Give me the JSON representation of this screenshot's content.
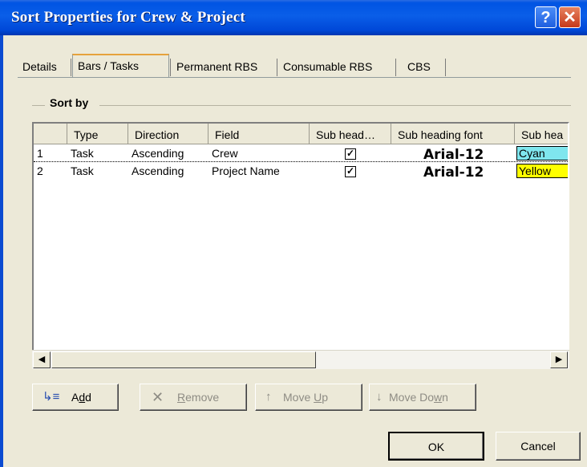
{
  "window": {
    "title": "Sort  Properties for  Crew & Project",
    "help_glyph": "?",
    "close_glyph": "✕"
  },
  "tabs": [
    {
      "label": "Details"
    },
    {
      "label": "Bars / Tasks"
    },
    {
      "label": "Permanent RBS"
    },
    {
      "label": "Consumable RBS"
    },
    {
      "label": "CBS"
    }
  ],
  "active_tab": "Bars / Tasks",
  "group": {
    "label": "Sort by"
  },
  "grid": {
    "columns": [
      "",
      "Type",
      "Direction",
      "Field",
      "Sub head…",
      "Sub heading font",
      "Sub hea"
    ],
    "rows": [
      {
        "num": "1",
        "type": "Task",
        "direction": "Ascending",
        "field": "Crew",
        "sub_head_checked": true,
        "check_glyph": "✓",
        "font": "Arial-12",
        "color": "Cyan",
        "color_hex": "#7fe6ee"
      },
      {
        "num": "2",
        "type": "Task",
        "direction": "Ascending",
        "field": "Project Name",
        "sub_head_checked": true,
        "check_glyph": "✓",
        "font": "Arial-12",
        "color": "Yellow",
        "color_hex": "#ffff00"
      }
    ]
  },
  "scrollbar": {
    "left_arrow": "◀",
    "right_arrow": "▶"
  },
  "buttons": {
    "add": {
      "icon": "↳≡",
      "label_pre": "A",
      "label_ul": "d",
      "label_post": "d"
    },
    "remove": {
      "icon": "✕",
      "label_pre": "",
      "label_ul": "R",
      "label_post": "emove"
    },
    "move_up": {
      "icon": "↑",
      "label_pre": "Move ",
      "label_ul": "U",
      "label_post": "p"
    },
    "move_down": {
      "icon": "↓",
      "label_pre": "Move Do",
      "label_ul": "w",
      "label_post": "n"
    },
    "ok": "OK",
    "cancel": "Cancel"
  }
}
